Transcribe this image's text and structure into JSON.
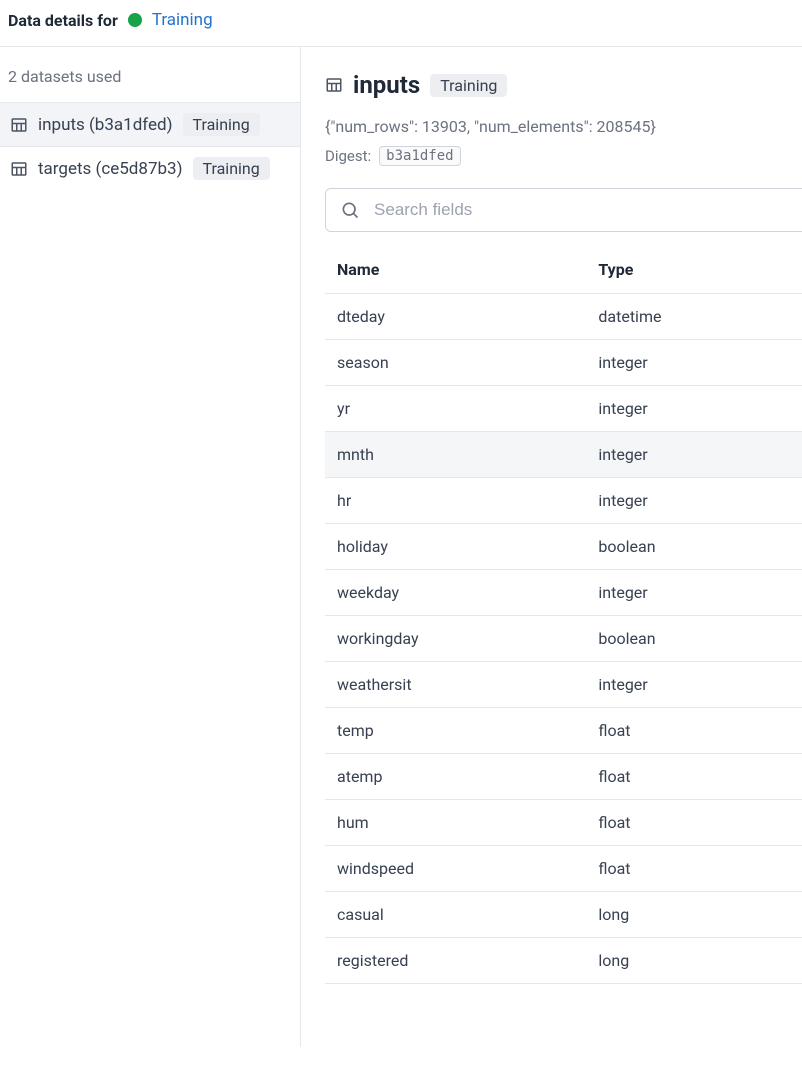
{
  "header": {
    "prefix": "Data details for",
    "status_link": "Training"
  },
  "sidebar": {
    "subtitle": "2 datasets used",
    "items": [
      {
        "label": "inputs (b3a1dfed)",
        "badge": "Training",
        "active": true
      },
      {
        "label": "targets (ce5d87b3)",
        "badge": "Training",
        "active": false
      }
    ]
  },
  "main": {
    "title": "inputs",
    "badge": "Training",
    "json_summary": "{\"num_rows\": 13903, \"num_elements\": 208545}",
    "digest_label": "Digest:",
    "digest_value": "b3a1dfed",
    "search_placeholder": "Search fields",
    "table": {
      "headers": {
        "name": "Name",
        "type": "Type"
      },
      "rows": [
        {
          "name": "dteday",
          "type": "datetime"
        },
        {
          "name": "season",
          "type": "integer"
        },
        {
          "name": "yr",
          "type": "integer"
        },
        {
          "name": "mnth",
          "type": "integer",
          "hover": true
        },
        {
          "name": "hr",
          "type": "integer"
        },
        {
          "name": "holiday",
          "type": "boolean"
        },
        {
          "name": "weekday",
          "type": "integer"
        },
        {
          "name": "workingday",
          "type": "boolean"
        },
        {
          "name": "weathersit",
          "type": "integer"
        },
        {
          "name": "temp",
          "type": "float"
        },
        {
          "name": "atemp",
          "type": "float"
        },
        {
          "name": "hum",
          "type": "float"
        },
        {
          "name": "windspeed",
          "type": "float"
        },
        {
          "name": "casual",
          "type": "long"
        },
        {
          "name": "registered",
          "type": "long"
        }
      ]
    }
  }
}
